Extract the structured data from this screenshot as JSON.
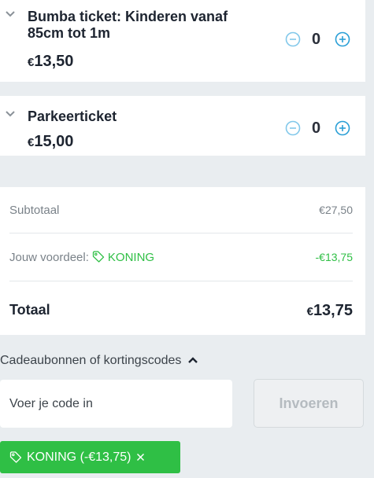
{
  "tickets": [
    {
      "name": "Bumba ticket: Kinderen vanaf 85cm tot 1m",
      "name_line1": "Bumba ticket: Kinderen vanaf",
      "name_line2": "85cm tot 1m",
      "currency": "€",
      "price": "13,50",
      "quantity": "0"
    },
    {
      "name": "Parkeerticket",
      "currency": "€",
      "price": "15,00",
      "quantity": "0"
    }
  ],
  "summary": {
    "subtotal_label": "Subtotaal",
    "subtotal_value": "€27,50",
    "discount_label": "Jouw voordeel:",
    "discount_code": "KONING",
    "discount_value": "-€13,75",
    "total_label": "Totaal",
    "total_currency": "€",
    "total_value": "13,75"
  },
  "codes": {
    "toggle_label": "Cadeaubonnen of kortingscodes",
    "input_placeholder": "Voer je code in",
    "apply_label": "Invoeren",
    "applied_chip": "KONING (-€13,75)"
  },
  "colors": {
    "accent": "#2a9fd6",
    "discount_green": "#2fbf45",
    "background": "#e9edf0"
  },
  "icons": [
    "chevron-down-icon",
    "minus-circle-icon",
    "plus-circle-icon",
    "tag-icon",
    "chevron-up-icon",
    "close-icon"
  ]
}
